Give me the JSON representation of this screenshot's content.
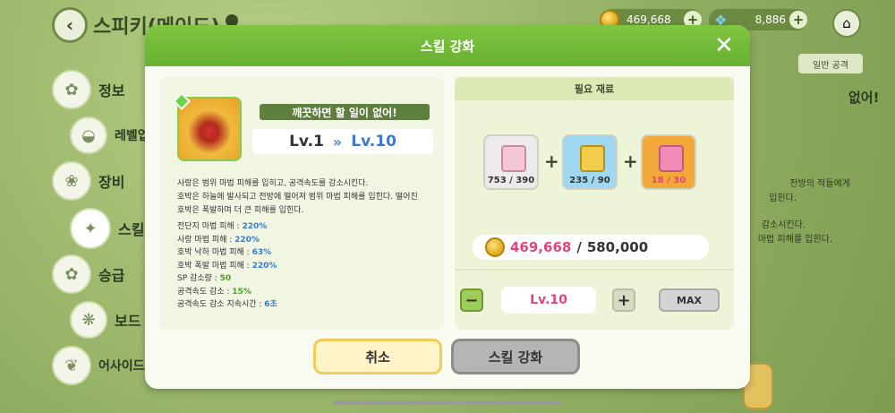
{
  "background": {
    "title": "스피키(메이드)",
    "currency_coins": "469,668",
    "currency_gems": "8,886",
    "sidebar": [
      {
        "label": "정보"
      },
      {
        "label": "레벨업"
      },
      {
        "label": "장비"
      },
      {
        "label": "스킬"
      },
      {
        "label": "승급"
      },
      {
        "label": "보드"
      },
      {
        "label": "어사이드"
      }
    ],
    "right_tab": "일반 공격",
    "right_head": "없어!",
    "right_lines": [
      "전방의 적들에게",
      "입힌다.",
      "감소시킨다.",
      "마법 피해를 입힌다."
    ]
  },
  "modal": {
    "title": "스킬 강화",
    "skill_tag": "깨끗하면 할 일이 없어!",
    "level_from": "Lv.1",
    "level_arrow": "»",
    "level_to": "Lv.10",
    "description": [
      "사랑은 범위 마법 피해를 입히고, 공격속도를 감소시킨다.",
      "호박은 하늘에 발사되고 전방에 떨어져 범위 마법 피해를 입힌다. 떨어진",
      "호박은 폭발하며 더 큰 피해를 입힌다."
    ],
    "stats": [
      {
        "label": "전단지 마법 피해 : ",
        "value": "220%",
        "color": "#3b7ad0"
      },
      {
        "label": "사랑 마법 피해 : ",
        "value": "220%",
        "color": "#3b7ad0"
      },
      {
        "label": "호박 낙하 마법 피해 : ",
        "value": "63%",
        "color": "#3b7ad0"
      },
      {
        "label": "호박 폭발 마법 피해 : ",
        "value": "220%",
        "color": "#3b7ad0"
      },
      {
        "label": "SP 감소량 : ",
        "value": "50",
        "color": "#4aa128"
      },
      {
        "label": "공격속도 감소 : ",
        "value": "15%",
        "color": "#4aa128"
      },
      {
        "label": "공격속도 감소 지속시간 : ",
        "value": "6초",
        "color": "#3b7ad0"
      }
    ],
    "required_header": "필요 재료",
    "materials": [
      {
        "count": "753 / 390",
        "icon": "pink-hammer-icon",
        "color": "#efeaea"
      },
      {
        "count": "235 / 90",
        "icon": "gold-hammer-icon",
        "color": "#9fd8f0"
      },
      {
        "count": "18 / 30",
        "icon": "pink-gold-hammer-icon",
        "color": "#f2a93a"
      }
    ],
    "plus_symbol": "+",
    "cost_have": "469,668",
    "cost_sep": "/",
    "cost_need": "580,000",
    "minus": "−",
    "plus": "+",
    "target_level": "Lv.10",
    "max_label": "MAX",
    "cancel_label": "취소",
    "upgrade_label": "스킬 강화",
    "close": "✕"
  }
}
